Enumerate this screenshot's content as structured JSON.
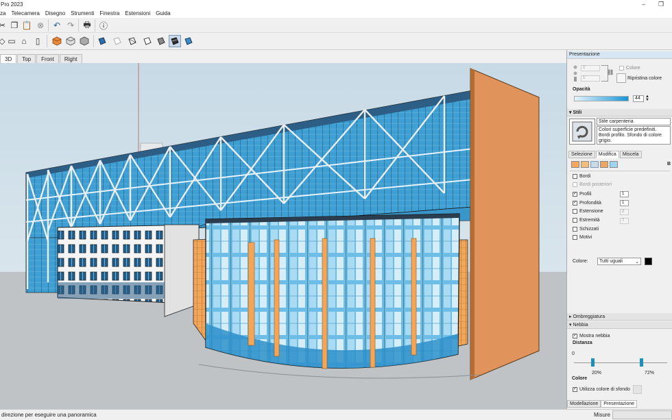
{
  "window": {
    "title": "Pro 2023",
    "minimize": "–",
    "restore": "❐"
  },
  "menu": [
    "za",
    "Telecamera",
    "Disegno",
    "Strumenti",
    "Finestra",
    "Estensioni",
    "Guida"
  ],
  "scene_tabs": [
    "3D",
    "Top",
    "Front",
    "Right"
  ],
  "status": {
    "message": "direzione per eseguire una panoramica",
    "measure_label": "Misure"
  },
  "tray": {
    "presentation_header": "Presentazione",
    "colore_label": "Colore",
    "ripristina_label": "Ripristina colore",
    "opacita_label": "Opacità",
    "opacity_value": "44",
    "stili_header": "Stili",
    "style_name": "Stile carpenteria",
    "style_desc": "Colori superficie predefiniti. Bordi profilo. Sfondo di colore grigio.",
    "tabs": [
      "Selezione",
      "Modifica",
      "Miscela"
    ],
    "edge_options": [
      {
        "label": "Bordi",
        "checked": false,
        "value": ""
      },
      {
        "label": "Bordi posteriori",
        "checked": false,
        "value": "",
        "disabled": true
      },
      {
        "label": "Profili",
        "checked": true,
        "value": "1"
      },
      {
        "label": "Profondità",
        "checked": true,
        "value": "1"
      },
      {
        "label": "Estensione",
        "checked": false,
        "value": "2"
      },
      {
        "label": "Estremità",
        "checked": false,
        "value": "7"
      },
      {
        "label": "Schizzati",
        "checked": false,
        "value": ""
      },
      {
        "label": "Motivi",
        "checked": false,
        "value": ""
      }
    ],
    "color_label": "Colore:",
    "color_select": "Tutti uguali",
    "ombreggiatura_header": "Ombreggiatura",
    "nebbia_header": "Nebbia",
    "mostra_nebbia": "Mostra nebbia",
    "distanza_label": "Distanza",
    "distanza_zero": "0",
    "slider_left": "20%",
    "slider_right": "72%",
    "fog_left_pct": 0.2,
    "fog_right_pct": 0.72,
    "colore_header": "Colore",
    "usa_sfondo": "Utilizza colore di sfondo",
    "bottom_tabs": [
      "Modellazione",
      "Presentazione"
    ]
  }
}
